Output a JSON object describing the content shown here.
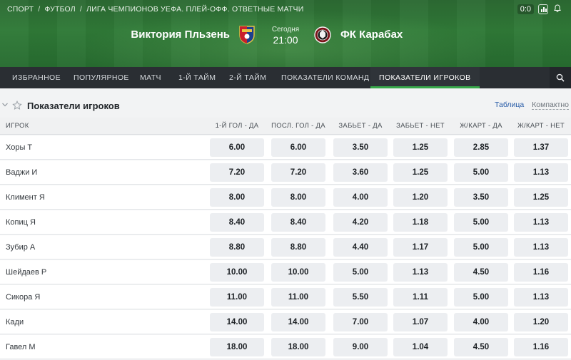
{
  "breadcrumb": [
    "СПОРТ",
    "ФУТБОЛ",
    "ЛИГА ЧЕМПИОНОВ УЕФА. ПЛЕЙ-ОФФ. ОТВЕТНЫЕ МАТЧИ"
  ],
  "header": {
    "score_button": "0:0"
  },
  "match": {
    "home_team": "Виктория Пльзень",
    "away_team": "ФК Карабах",
    "day": "Сегодня",
    "time": "21:00"
  },
  "tabs": [
    {
      "label": "ИЗБРАННОЕ"
    },
    {
      "label": "ПОПУЛЯРНОЕ"
    },
    {
      "label": "МАТЧ"
    },
    {
      "label": "1-Й ТАЙМ"
    },
    {
      "label": "2-Й ТАЙМ"
    },
    {
      "label": "ПОКАЗАТЕЛИ КОМАНД"
    },
    {
      "label": "ПОКАЗАТЕЛИ ИГРОКОВ",
      "active": true
    }
  ],
  "section": {
    "title": "Показатели игроков",
    "view_table": "Таблица",
    "view_compact": "Компактно"
  },
  "table": {
    "columns": [
      "ИГРОК",
      "1-Й ГОЛ - ДА",
      "ПОСЛ. ГОЛ - ДА",
      "ЗАБЬЕТ - ДА",
      "ЗАБЬЕТ - НЕТ",
      "Ж/КАРТ - ДА",
      "Ж/КАРТ - НЕТ"
    ],
    "rows": [
      {
        "player": "Хоры Т",
        "odds": [
          "6.00",
          "6.00",
          "3.50",
          "1.25",
          "2.85",
          "1.37"
        ]
      },
      {
        "player": "Ваджи И",
        "odds": [
          "7.20",
          "7.20",
          "3.60",
          "1.25",
          "5.00",
          "1.13"
        ]
      },
      {
        "player": "Климент Я",
        "odds": [
          "8.00",
          "8.00",
          "4.00",
          "1.20",
          "3.50",
          "1.25"
        ]
      },
      {
        "player": "Копиц Я",
        "odds": [
          "8.40",
          "8.40",
          "4.20",
          "1.18",
          "5.00",
          "1.13"
        ]
      },
      {
        "player": "Зубир А",
        "odds": [
          "8.80",
          "8.80",
          "4.40",
          "1.17",
          "5.00",
          "1.13"
        ]
      },
      {
        "player": "Шейдаев Р",
        "odds": [
          "10.00",
          "10.00",
          "5.00",
          "1.13",
          "4.50",
          "1.16"
        ]
      },
      {
        "player": "Сикора Я",
        "odds": [
          "11.00",
          "11.00",
          "5.50",
          "1.11",
          "5.00",
          "1.13"
        ]
      },
      {
        "player": "Кади",
        "odds": [
          "14.00",
          "14.00",
          "7.00",
          "1.07",
          "4.00",
          "1.20"
        ]
      },
      {
        "player": "Гавел М",
        "odds": [
          "18.00",
          "18.00",
          "9.00",
          "1.04",
          "4.50",
          "1.16"
        ]
      }
    ]
  },
  "colors": {
    "hero_green": "#2f7a37",
    "tab_bar": "#2a2e33",
    "tab_active_underline": "#37a94a",
    "odd_button_bg": "#eceef1",
    "link_blue": "#2a5da8"
  },
  "icons": {
    "collapse": "chevron-down-icon",
    "favorite": "star-icon",
    "search": "search-icon",
    "stats": "stats-icon",
    "home_crest": "viktoria-plzen-crest-icon",
    "away_crest": "qarabag-crest-icon"
  }
}
